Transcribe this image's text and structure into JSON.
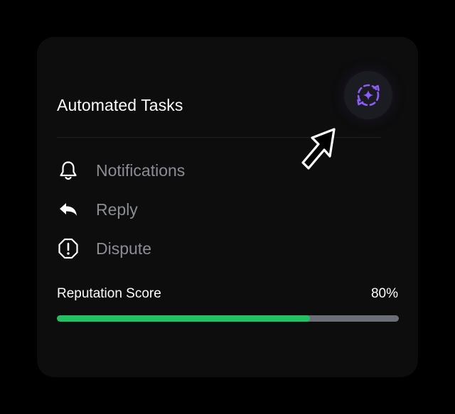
{
  "card": {
    "title": "Automated Tasks"
  },
  "ai_button": {
    "icon": "ai-sparkle-refresh-icon",
    "accent_color": "#8b5cf6"
  },
  "tasks": [
    {
      "label": "Notifications",
      "icon": "bell-icon"
    },
    {
      "label": "Reply",
      "icon": "reply-icon"
    },
    {
      "label": "Dispute",
      "icon": "alert-octagon-icon"
    }
  ],
  "reputation": {
    "label": "Reputation Score",
    "value_text": "80%",
    "progress_fraction": 0.74,
    "fill_color": "#22c163",
    "track_color": "#6b6e75"
  },
  "cursor": {
    "icon": "pointer-arrow-icon"
  }
}
